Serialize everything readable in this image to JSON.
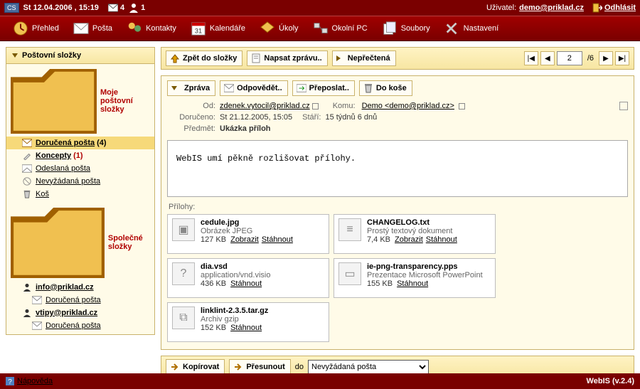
{
  "topbar": {
    "locale_badge": "CS",
    "datetime": "St 12.04.2006 , 15:19",
    "mail_count": "4",
    "user_count": "1",
    "user_label": "Uživatel:",
    "user_email": "demo@priklad.cz",
    "logout": "Odhlásit"
  },
  "nav": {
    "overview": "Přehled",
    "mail": "Pošta",
    "contacts": "Kontakty",
    "calendar": "Kalendáře",
    "tasks": "Úkoly",
    "pcs": "Okolní PC",
    "files": "Soubory",
    "settings": "Nastavení"
  },
  "sidebar": {
    "header": "Poštovní složky",
    "group_my": "Moje poštovní složky",
    "inbox": "Doručená pošta",
    "inbox_count": "(4)",
    "drafts": "Koncepty",
    "drafts_count": "(1)",
    "sent": "Odeslaná pošta",
    "junk": "Nevyžádaná pošta",
    "trash": "Koš",
    "group_shared": "Společné složky",
    "shared1": "info@priklad.cz",
    "shared1_inbox": "Doručená pošta",
    "shared2": "vtipy@priklad.cz",
    "shared2_inbox": "Doručená pošta"
  },
  "listbar": {
    "back": "Zpět do složky",
    "compose": "Napsat zprávu..",
    "unread": "Nepřečtená",
    "page": "2",
    "total": "/6"
  },
  "msgbar": {
    "message": "Zpráva",
    "reply": "Odpovědět..",
    "forward": "Přeposlat..",
    "delete": "Do koše"
  },
  "msg": {
    "from_lbl": "Od:",
    "from_val": "zdenek.vytocil@priklad.cz",
    "to_lbl": "Komu:",
    "to_val": "Demo <demo@priklad.cz>",
    "delivered_lbl": "Doručeno:",
    "delivered_val": "St 21.12.2005, 15:05",
    "age_lbl": "Stáří:",
    "age_val": "15 týdnů 6 dnů",
    "subject_lbl": "Předmět:",
    "subject_val": "Ukázka příloh",
    "body": "WebIS umí pěkně rozlišovat přílohy."
  },
  "att": {
    "label": "Přílohy:",
    "view": "Zobrazit",
    "download": "Stáhnout",
    "items": [
      {
        "name": "cedule.jpg",
        "type": "Obrázek JPEG",
        "size": "127 KB",
        "view": true,
        "glyph": "▣"
      },
      {
        "name": "CHANGELOG.txt",
        "type": "Prostý textový dokument",
        "size": "7,4 KB",
        "view": true,
        "glyph": "≡"
      },
      {
        "name": "dia.vsd",
        "type": "application/vnd.visio",
        "size": "436 KB",
        "view": false,
        "glyph": "?"
      },
      {
        "name": "ie-png-transparency.pps",
        "type": "Prezentace Microsoft PowerPoint",
        "size": "155 KB",
        "view": false,
        "glyph": "▭"
      },
      {
        "name": "linklint-2.3.5.tar.gz",
        "type": "Archiv gzip",
        "size": "152 KB",
        "view": false,
        "glyph": "⧉"
      }
    ]
  },
  "movebar": {
    "copy": "Kopírovat",
    "move": "Přesunout",
    "to_lbl": "do",
    "target": "Nevyžádaná pošta"
  },
  "footer": {
    "help": "Nápověda",
    "version": "WebIS (v.2.4)"
  }
}
